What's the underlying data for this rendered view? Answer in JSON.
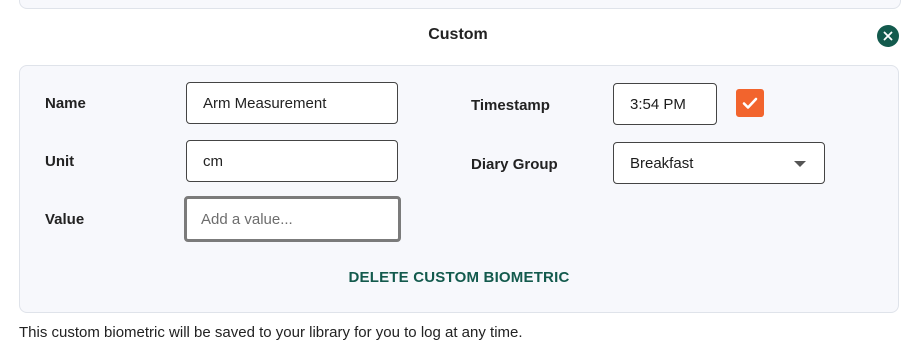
{
  "dialog": {
    "title": "Custom",
    "close_icon": "close-icon"
  },
  "form": {
    "name_label": "Name",
    "name_value": "Arm Measurement",
    "unit_label": "Unit",
    "unit_value": "cm",
    "value_label": "Value",
    "value_value": "",
    "value_placeholder": "Add a value...",
    "timestamp_label": "Timestamp",
    "timestamp_value": "3:54 PM",
    "timestamp_checked": true,
    "diary_group_label": "Diary Group",
    "diary_group_value": "Breakfast",
    "delete_label": "DELETE CUSTOM BIOMETRIC"
  },
  "footer": {
    "note": "This custom biometric will be saved to your library for you to log at any time."
  },
  "colors": {
    "accent_green": "#135a4d",
    "checkbox_orange": "#f2642d",
    "card_background": "#f7f8fc"
  }
}
